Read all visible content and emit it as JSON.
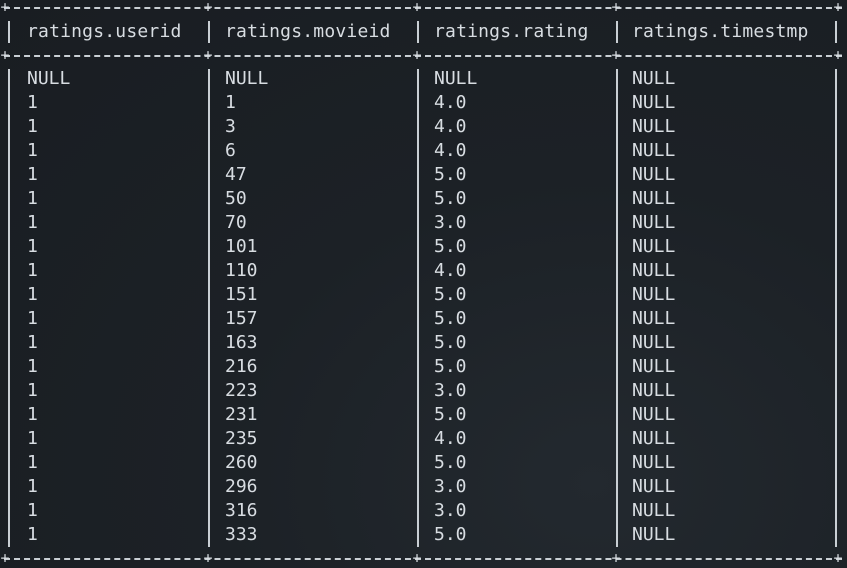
{
  "table": {
    "columns": [
      "ratings.userid",
      "ratings.movieid",
      "ratings.rating",
      "ratings.timestmp"
    ],
    "rows": [
      [
        "NULL",
        "NULL",
        "NULL",
        "NULL"
      ],
      [
        "1",
        "1",
        "4.0",
        "NULL"
      ],
      [
        "1",
        "3",
        "4.0",
        "NULL"
      ],
      [
        "1",
        "6",
        "4.0",
        "NULL"
      ],
      [
        "1",
        "47",
        "5.0",
        "NULL"
      ],
      [
        "1",
        "50",
        "5.0",
        "NULL"
      ],
      [
        "1",
        "70",
        "3.0",
        "NULL"
      ],
      [
        "1",
        "101",
        "5.0",
        "NULL"
      ],
      [
        "1",
        "110",
        "4.0",
        "NULL"
      ],
      [
        "1",
        "151",
        "5.0",
        "NULL"
      ],
      [
        "1",
        "157",
        "5.0",
        "NULL"
      ],
      [
        "1",
        "163",
        "5.0",
        "NULL"
      ],
      [
        "1",
        "216",
        "5.0",
        "NULL"
      ],
      [
        "1",
        "223",
        "3.0",
        "NULL"
      ],
      [
        "1",
        "231",
        "5.0",
        "NULL"
      ],
      [
        "1",
        "235",
        "4.0",
        "NULL"
      ],
      [
        "1",
        "260",
        "5.0",
        "NULL"
      ],
      [
        "1",
        "296",
        "3.0",
        "NULL"
      ],
      [
        "1",
        "316",
        "3.0",
        "NULL"
      ],
      [
        "1",
        "333",
        "5.0",
        "NULL"
      ]
    ]
  }
}
